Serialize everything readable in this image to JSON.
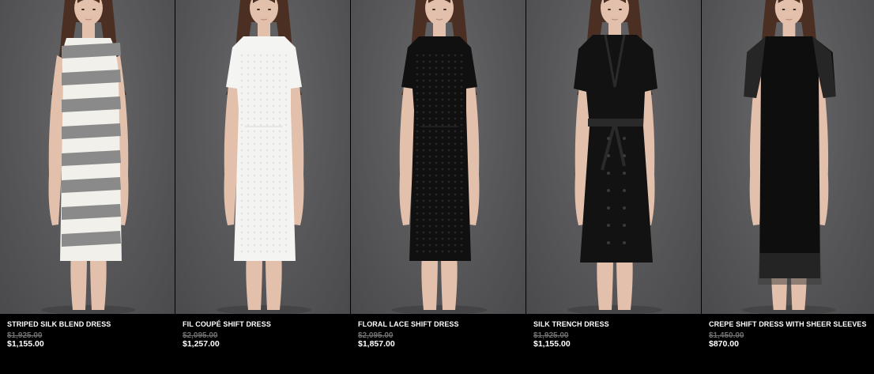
{
  "products": [
    {
      "name": "STRIPED SILK BLEND DRESS",
      "original_price": "$1,925.00",
      "sale_price": "$1,155.00",
      "dress_style": "striped",
      "dress_color": "#f2f0ea",
      "accent_color": "#8a8a8a"
    },
    {
      "name": "FIL COUPÉ SHIFT DRESS",
      "original_price": "$2,095.00",
      "sale_price": "$1,257.00",
      "dress_style": "shift",
      "dress_color": "#f4f4f2",
      "accent_color": "#e2e2de"
    },
    {
      "name": "FLORAL LACE SHIFT DRESS",
      "original_price": "$2,095.00",
      "sale_price": "$1,857.00",
      "dress_style": "shift",
      "dress_color": "#101010",
      "accent_color": "#262626"
    },
    {
      "name": "SILK TRENCH DRESS",
      "original_price": "$1,925.00",
      "sale_price": "$1,155.00",
      "dress_style": "trench",
      "dress_color": "#121212",
      "accent_color": "#2a2a2a"
    },
    {
      "name": "CREPE SHIFT DRESS WITH SHEER SLEEVES",
      "original_price": "$1,450.00",
      "sale_price": "$870.00",
      "dress_style": "sheer",
      "dress_color": "#0e0e0e",
      "accent_color": "#3a3a3a"
    }
  ],
  "colors": {
    "background": "#000000",
    "studio_backdrop": "#5a5a5c",
    "text_primary": "#ffffff",
    "text_strikethrough": "#6e6e6e",
    "skin": "#e2c0ab",
    "hair": "#4a2f22"
  }
}
